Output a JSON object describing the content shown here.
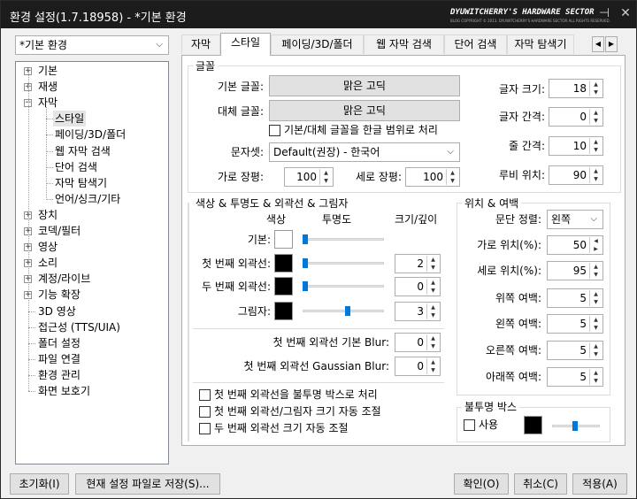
{
  "window": {
    "title": "환경 설정(1.7.18958) - *기본 환경",
    "brand": "DYUWITCHERRY'S HARDWARE SECTOR",
    "brand_sub": "BLOG COPYRIGHT © 2013. DYUWITCHERRY'S HARDWARE SECTOR ALL RIGHTS RESERVED.",
    "pin": "⊣",
    "close": "✕"
  },
  "preset": {
    "value": "*기본 환경"
  },
  "tree": {
    "items": [
      "기본",
      "재생",
      "자막",
      "스타일",
      "페이딩/3D/폴더",
      "웹 자막 검색",
      "단어 검색",
      "자막 탐색기",
      "언어/싱크/기타",
      "장치",
      "코덱/필터",
      "영상",
      "소리",
      "계정/라이브",
      "기능 확장",
      "3D 영상",
      "접근성 (TTS/UIA)",
      "폴더 설정",
      "파일 연결",
      "환경 관리",
      "화면 보호기"
    ]
  },
  "tabs": [
    "자막",
    "스타일",
    "페이딩/3D/폴더",
    "웹 자막 검색",
    "단어 검색",
    "자막 탐색기"
  ],
  "font": {
    "group": "글꼴",
    "base_label": "기본 글꼴:",
    "base_value": "맑은 고딕",
    "alt_label": "대체 글꼴:",
    "alt_value": "맑은 고딕",
    "korean_range": "기본/대체 글꼴을 한글 범위로 처리",
    "charset_label": "문자셋:",
    "charset_value": "Default(권장) - 한국어",
    "hscale_label": "가로 장평:",
    "hscale": "100",
    "vscale_label": "세로 장평:",
    "vscale": "100",
    "size_label": "글자 크기:",
    "size": "18",
    "spacing_label": "글자 간격:",
    "spacing": "0",
    "line_label": "줄 간격:",
    "line": "10",
    "ruby_label": "루비 위치:",
    "ruby": "90"
  },
  "colors": {
    "group": "색상 & 투명도 & 외곽선 & 그림자",
    "col_color": "색상",
    "col_opacity": "투명도",
    "col_size": "크기/깊이",
    "rows": [
      {
        "label": "기본:",
        "color": "#ffffff",
        "opacity": 0.0,
        "size": ""
      },
      {
        "label": "첫 번째 외곽선:",
        "color": "#000000",
        "opacity": 0.0,
        "size": "2"
      },
      {
        "label": "두 번째 외곽선:",
        "color": "#000000",
        "opacity": 0.0,
        "size": "0"
      },
      {
        "label": "그림자:",
        "color": "#000000",
        "opacity": 0.55,
        "size": "3"
      }
    ],
    "blur_label": "첫 번째 외곽선 기본 Blur:",
    "blur": "0",
    "gblur_label": "첫 번째 외곽선 Gaussian Blur:",
    "gblur": "0",
    "opt1": "첫 번째 외곽선을 불투명 박스로 처리",
    "opt2": "첫 번째 외곽선/그림자 크기 자동 조절",
    "opt3": "두 번째 외곽선 크기 자동 조절"
  },
  "position": {
    "group": "위치 & 여백",
    "align_label": "문단 정렬:",
    "align": "왼쪽",
    "hpos_label": "가로 위치(%):",
    "hpos": "50",
    "vpos_label": "세로 위치(%):",
    "vpos": "95",
    "top_label": "위쪽 여백:",
    "top": "5",
    "left_label": "왼쪽 여백:",
    "left": "5",
    "right_label": "오른쪽 여백:",
    "right": "5",
    "bottom_label": "아래쪽 여백:",
    "bottom": "5"
  },
  "opaque": {
    "group": "불투명 박스",
    "use": "사용",
    "color": "#000000",
    "opacity": 0.45
  },
  "buttons": {
    "reset": "초기화(I)",
    "save": "현재 설정 파일로 저장(S)...",
    "ok": "확인(O)",
    "cancel": "취소(C)",
    "apply": "적용(A)"
  }
}
